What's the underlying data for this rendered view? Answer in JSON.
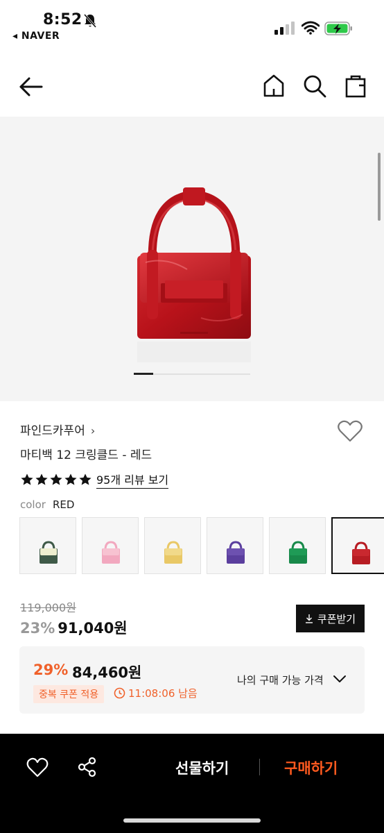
{
  "status_bar": {
    "time": "8:52",
    "back_app": "◂ NAVER"
  },
  "product": {
    "brand": "파인드카푸어",
    "brand_chevron": "›",
    "name": "마티백 12 크링클드 - 레드",
    "rating_stars": 5,
    "review_link": "95개 리뷰 보기",
    "color_label": "color",
    "color_value": "RED",
    "swatches": [
      {
        "color": "#3f5a48",
        "accent": "#eeeecf"
      },
      {
        "color": "#f2a8bf",
        "accent": "#f7c2d1"
      },
      {
        "color": "#e9c866",
        "accent": "#f1d98a"
      },
      {
        "color": "#5b3f9e",
        "accent": "#6d51b0"
      },
      {
        "color": "#18894a",
        "accent": "#1f9b56"
      },
      {
        "color": "#b71c23",
        "accent": "#c9282f"
      }
    ],
    "selected_swatch_index": 5,
    "original_price": "119,000원",
    "discount_rate": "23%",
    "sale_price": "91,040원",
    "coupon_button": "쿠폰받기"
  },
  "my_price": {
    "discount_rate": "29%",
    "price": "84,460원",
    "badge": "중복 쿠폰 적용",
    "timer": "11:08:06 남음",
    "label": "나의 구매 가능 가격"
  },
  "bottom_bar": {
    "gift_label": "선물하기",
    "buy_label": "구매하기"
  },
  "colors": {
    "accent": "#f0612a",
    "buy": "#ff5a1f",
    "bag_red": "#c0141c"
  }
}
